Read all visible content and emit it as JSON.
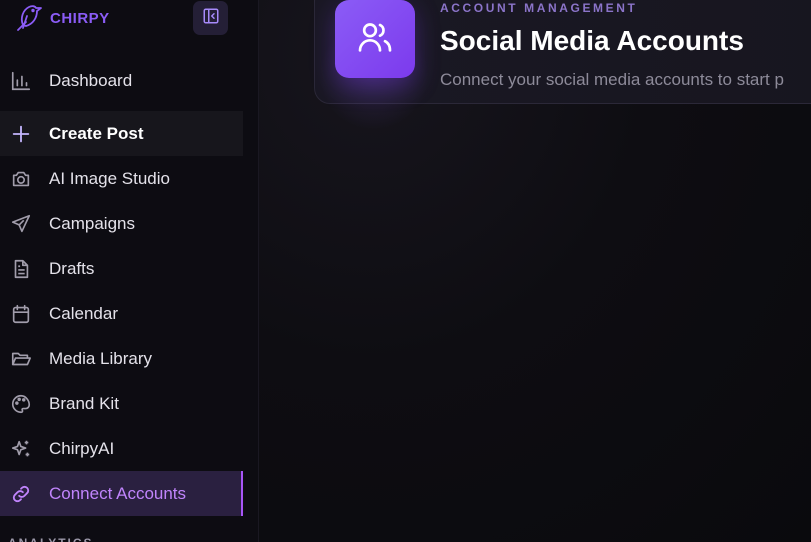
{
  "brand": {
    "name": "CHIRPY",
    "color": "#8b5cf6"
  },
  "sidebar": {
    "collapse_icon": "sidebar-collapse-icon",
    "items": [
      {
        "label": "Dashboard",
        "icon": "bar-chart-icon"
      },
      {
        "label": "Create Post",
        "icon": "plus-icon"
      },
      {
        "label": "AI Image Studio",
        "icon": "camera-icon"
      },
      {
        "label": "Campaigns",
        "icon": "plane-icon"
      },
      {
        "label": "Drafts",
        "icon": "document-icon"
      },
      {
        "label": "Calendar",
        "icon": "calendar-icon"
      },
      {
        "label": "Media Library",
        "icon": "folder-open-icon"
      },
      {
        "label": "Brand Kit",
        "icon": "palette-icon"
      },
      {
        "label": "ChirpyAI",
        "icon": "sparkles-icon"
      },
      {
        "label": "Connect Accounts",
        "icon": "link-icon",
        "active": true
      }
    ],
    "section_label": "ANALYTICS",
    "active_color": "#c084fc"
  },
  "header": {
    "eyebrow": "ACCOUNT MANAGEMENT",
    "title": "Social Media Accounts",
    "subtitle": "Connect your social media accounts to start p",
    "icon": "users-icon",
    "accent": "#8b5cf6"
  }
}
